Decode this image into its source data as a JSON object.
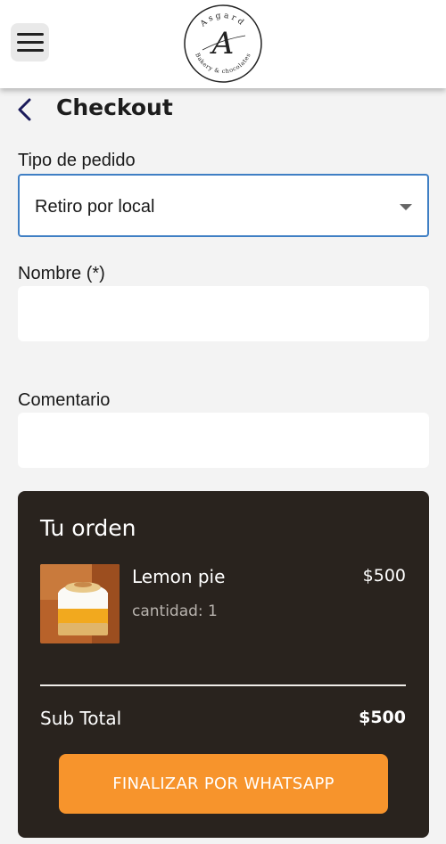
{
  "header": {
    "menu_icon": "hamburger-menu-icon",
    "logo": {
      "letter": "A",
      "ring_text": "Asgard Bakery & chocolates"
    }
  },
  "checkout": {
    "title": "Checkout",
    "back_icon": "chevron-left-icon"
  },
  "form": {
    "order_type_label": "Tipo de pedido",
    "order_type_value": "Retiro por local",
    "name_label": "Nombre (*)",
    "name_value": "",
    "comment_label": "Comentario",
    "comment_value": ""
  },
  "order": {
    "title": "Tu orden",
    "items": [
      {
        "name": "Lemon pie",
        "quantity_text": "cantidad: 1",
        "price": "$500",
        "image_icon": "lemon-pie-image"
      }
    ],
    "subtotal_label": "Sub Total",
    "subtotal_value": "$500",
    "submit_label": "FINALIZAR POR WHATSAPP"
  },
  "colors": {
    "accent": "#f7942c",
    "order_bg": "#29231e",
    "focus_border": "#3f7fc4",
    "back_icon": "#1a1a5a"
  }
}
